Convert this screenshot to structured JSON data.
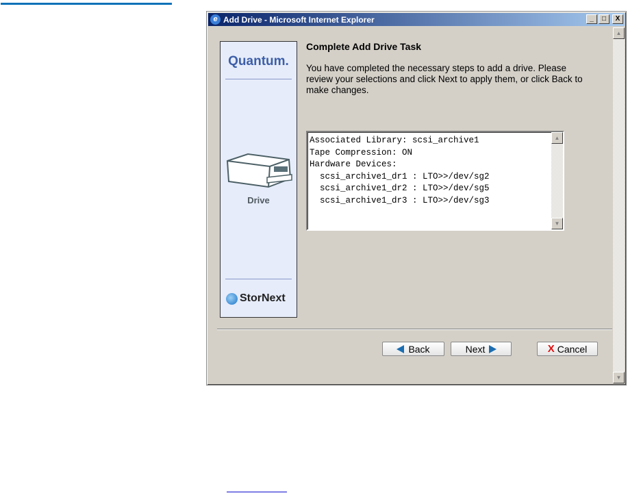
{
  "window": {
    "title": "Add Drive - Microsoft Internet Explorer",
    "controls": [
      "_",
      "□",
      "X"
    ]
  },
  "sidebar": {
    "brand": "Quantum.",
    "device_label": "Drive",
    "product": "StorNext"
  },
  "main": {
    "heading": "Complete Add Drive Task",
    "intro": "You have completed the necessary steps to add a drive. Please review your selections and click Next to apply them, or click Back to make changes.",
    "summary": "Associated Library: scsi_archive1\nTape Compression: ON\nHardware Devices:\n  scsi_archive1_dr1 : LTO>>/dev/sg2\n  scsi_archive1_dr2 : LTO>>/dev/sg5\n  scsi_archive1_dr3 : LTO>>/dev/sg3"
  },
  "buttons": {
    "back": "Back",
    "next": "Next",
    "cancel": "Cancel",
    "cancel_icon": "X"
  },
  "colors": {
    "accent": "#0a72b8",
    "brand": "#3d5fa8"
  }
}
